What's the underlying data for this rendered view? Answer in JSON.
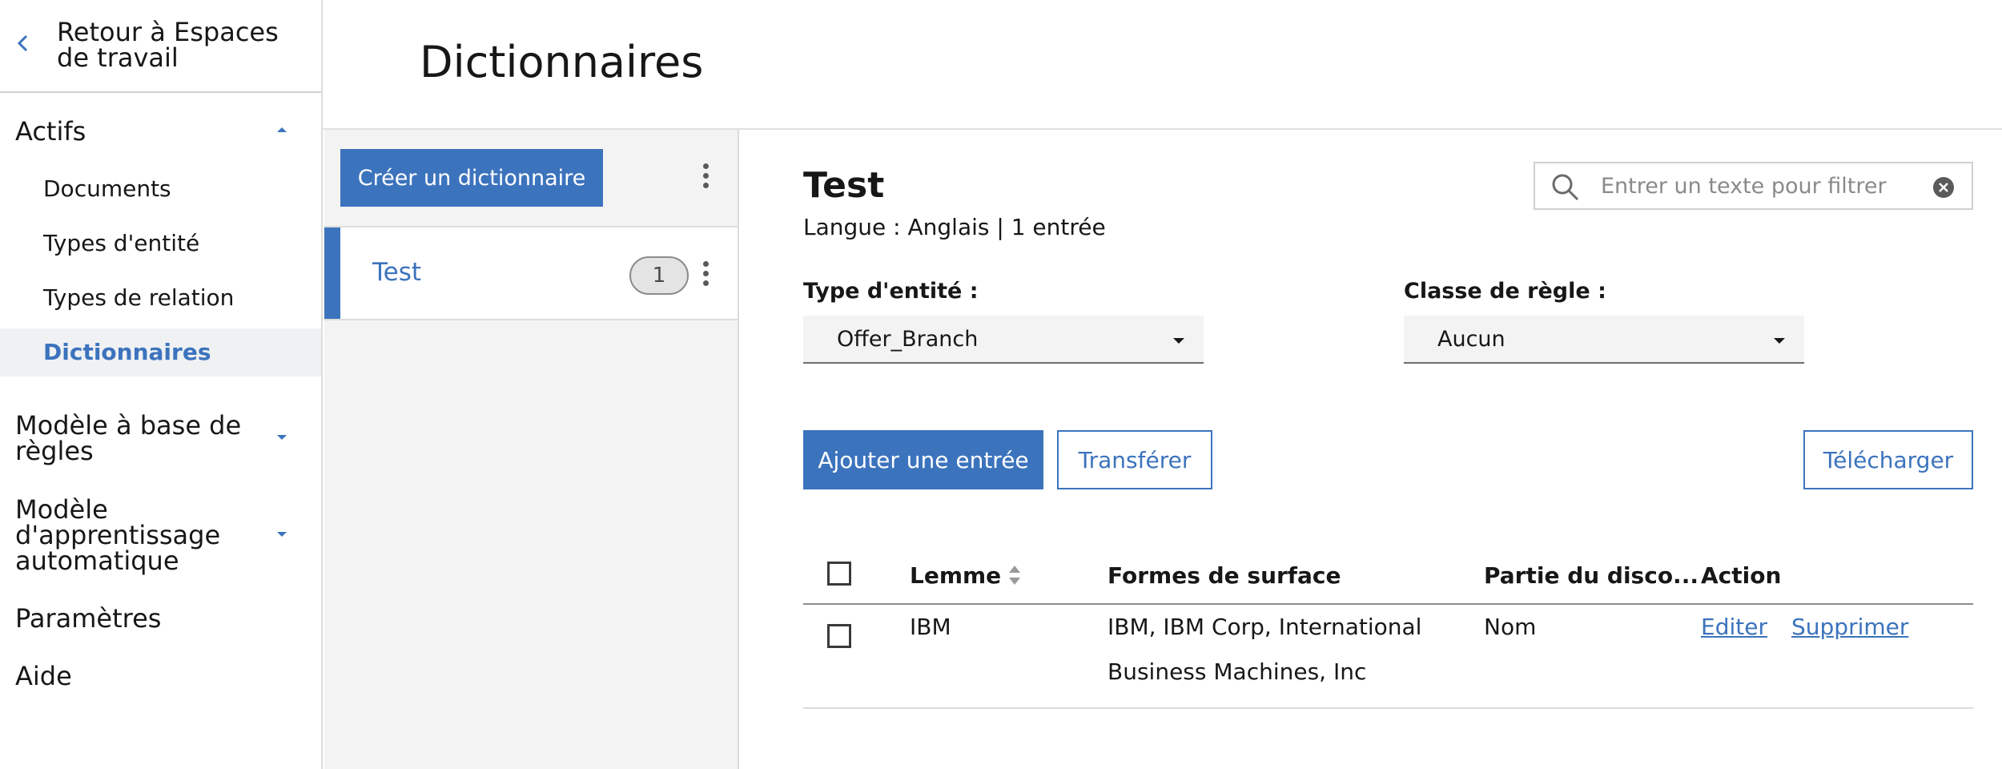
{
  "nav": {
    "back_label": "Retour à Espaces de travail",
    "sections": [
      {
        "label": "Actifs",
        "expanded": true
      },
      {
        "label": "Modèle à base de règles",
        "expanded": false
      },
      {
        "label": "Modèle d'apprentissage automatique",
        "expanded": false
      },
      {
        "label": "Paramètres"
      },
      {
        "label": "Aide"
      }
    ],
    "assets_items": [
      {
        "label": "Documents",
        "active": false
      },
      {
        "label": "Types d'entité",
        "active": false
      },
      {
        "label": "Types de relation",
        "active": false
      },
      {
        "label": "Dictionnaires",
        "active": true
      }
    ]
  },
  "page": {
    "title": "Dictionnaires"
  },
  "dict_list": {
    "create_label": "Créer un dictionnaire",
    "items": [
      {
        "name": "Test",
        "count": "1",
        "selected": true
      }
    ]
  },
  "detail": {
    "title": "Test",
    "meta": "Langue : Anglais | 1 entrée",
    "search_placeholder": "Entrer un texte pour filtrer",
    "entity_type": {
      "label": "Type d'entité :",
      "value": "Offer_Branch"
    },
    "rule_class": {
      "label": "Classe de règle :",
      "value": "Aucun"
    },
    "add_label": "Ajouter une entrée",
    "transfer_label": "Transférer",
    "download_label": "Télécharger"
  },
  "table": {
    "columns": [
      "Lemme",
      "Formes de surface",
      "Partie du disco...",
      "Action"
    ],
    "rows": [
      {
        "lemma": "IBM",
        "surface_forms_line1": "IBM, IBM Corp, International",
        "surface_forms_line2": "Business Machines, Inc",
        "pos": "Nom",
        "edit_label": "Editer",
        "delete_label": "Supprimer"
      }
    ]
  },
  "colors": {
    "accent": "#3c73bd",
    "nav_active_bg": "#eff1f3",
    "panel_bg": "#f3f3f3"
  }
}
